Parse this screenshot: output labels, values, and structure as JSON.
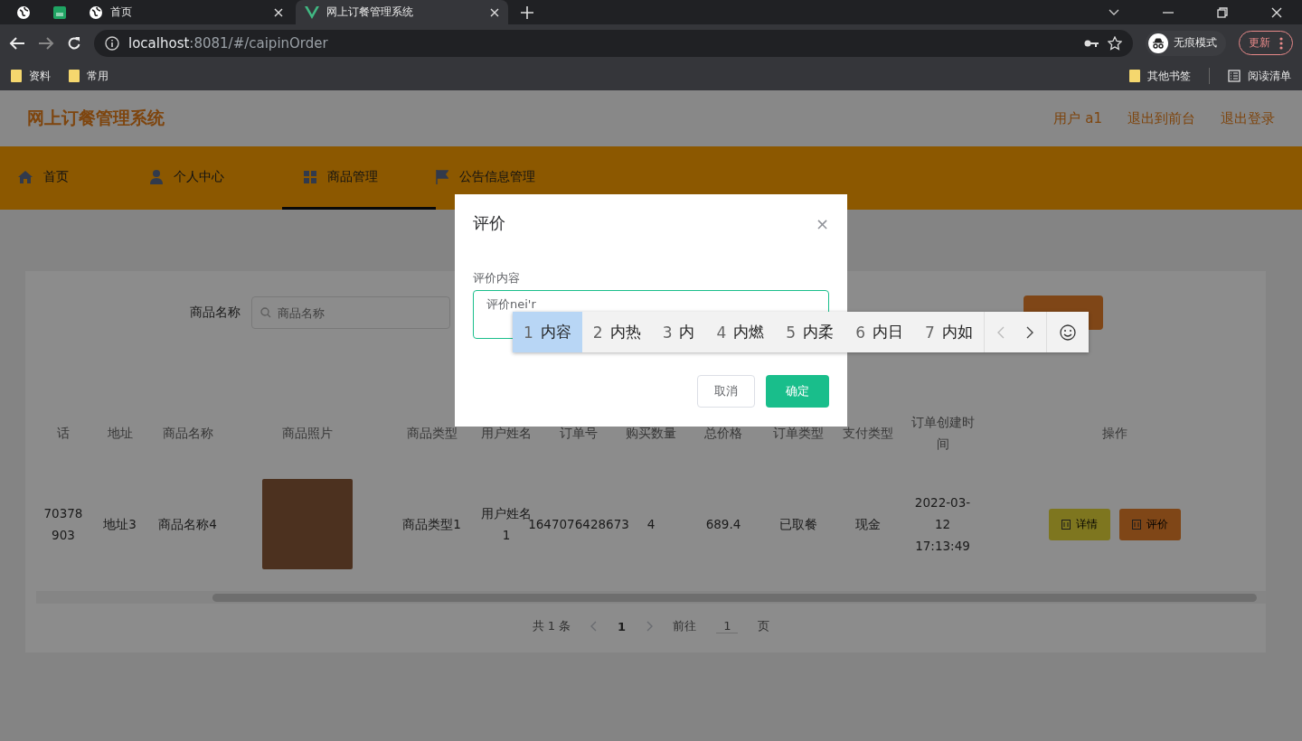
{
  "browser": {
    "tabs": [
      {
        "kind": "globe",
        "selected": false
      },
      {
        "kind": "sheet",
        "selected": false
      },
      {
        "kind": "globe",
        "title": "首页",
        "selected": false
      },
      {
        "kind": "vue",
        "title": "网上订餐管理系统",
        "selected": true
      }
    ],
    "url_host": "localhost",
    "url_rest": ":8081/#/caipinOrder",
    "incognito": "无痕模式",
    "update": "更新",
    "bookmarks": [
      "资料",
      "常用"
    ],
    "other_bookmarks": "其他书签",
    "reading_list": "阅读清单"
  },
  "header": {
    "title": "网上订餐管理系统",
    "links": [
      "用户 a1",
      "退出到前台",
      "退出登录"
    ]
  },
  "nav": [
    {
      "kind": "home",
      "label": "首页",
      "selected": false
    },
    {
      "kind": "user",
      "label": "个人中心",
      "selected": false
    },
    {
      "kind": "grid",
      "label": "商品管理",
      "selected": true
    },
    {
      "kind": "flag",
      "label": "公告信息管理",
      "selected": false
    }
  ],
  "search": {
    "label": "商品名称",
    "placeholder": "商品名称"
  },
  "table": {
    "columns": [
      "话",
      "地址",
      "商品名称",
      "商品照片",
      "商品类型",
      "用户姓名",
      "订单号",
      "购买数量",
      "总价格",
      "订单类型",
      "支付类型",
      "订单创建时间",
      "操作"
    ],
    "rows": [
      {
        "cells": [
          "70378 903",
          "地址3",
          "商品名称4",
          "",
          "商品类型1",
          "用户姓名1",
          "1647076428673",
          "4",
          "689.4",
          "已取餐",
          "现金",
          "2022-03-12 17:13:49"
        ],
        "actions": [
          {
            "label": "详情",
            "kind": "info"
          },
          {
            "label": "评价",
            "kind": "review"
          }
        ]
      }
    ]
  },
  "pagination": {
    "total": "共 1 条",
    "page": "1",
    "goto": "前往",
    "goto_value": "1",
    "page_unit": "页"
  },
  "dialog": {
    "title": "评价",
    "close": "×",
    "label": "评价内容",
    "value": "评价nei'r",
    "cancel": "取消",
    "confirm": "确定"
  },
  "ime": {
    "candidates": [
      {
        "index": "1",
        "text": "内容",
        "selected": true
      },
      {
        "index": "2",
        "text": "内热",
        "selected": false
      },
      {
        "index": "3",
        "text": "内",
        "selected": false
      },
      {
        "index": "4",
        "text": "内燃",
        "selected": false
      },
      {
        "index": "5",
        "text": "内柔",
        "selected": false
      },
      {
        "index": "6",
        "text": "内日",
        "selected": false
      },
      {
        "index": "7",
        "text": "内如",
        "selected": false
      }
    ]
  }
}
